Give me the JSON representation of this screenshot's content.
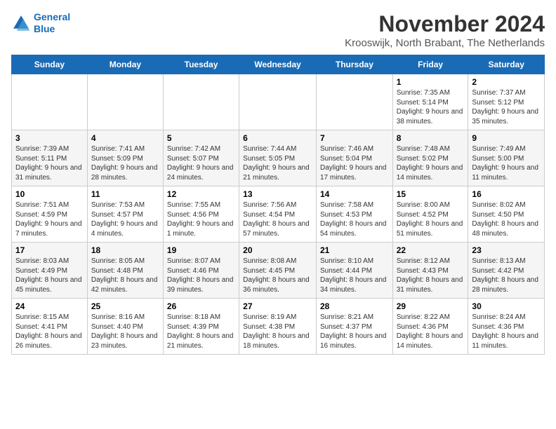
{
  "logo": {
    "line1": "General",
    "line2": "Blue"
  },
  "title": "November 2024",
  "subtitle": "Krooswijk, North Brabant, The Netherlands",
  "days_of_week": [
    "Sunday",
    "Monday",
    "Tuesday",
    "Wednesday",
    "Thursday",
    "Friday",
    "Saturday"
  ],
  "weeks": [
    [
      {
        "day": "",
        "info": ""
      },
      {
        "day": "",
        "info": ""
      },
      {
        "day": "",
        "info": ""
      },
      {
        "day": "",
        "info": ""
      },
      {
        "day": "",
        "info": ""
      },
      {
        "day": "1",
        "info": "Sunrise: 7:35 AM\nSunset: 5:14 PM\nDaylight: 9 hours and 38 minutes."
      },
      {
        "day": "2",
        "info": "Sunrise: 7:37 AM\nSunset: 5:12 PM\nDaylight: 9 hours and 35 minutes."
      }
    ],
    [
      {
        "day": "3",
        "info": "Sunrise: 7:39 AM\nSunset: 5:11 PM\nDaylight: 9 hours and 31 minutes."
      },
      {
        "day": "4",
        "info": "Sunrise: 7:41 AM\nSunset: 5:09 PM\nDaylight: 9 hours and 28 minutes."
      },
      {
        "day": "5",
        "info": "Sunrise: 7:42 AM\nSunset: 5:07 PM\nDaylight: 9 hours and 24 minutes."
      },
      {
        "day": "6",
        "info": "Sunrise: 7:44 AM\nSunset: 5:05 PM\nDaylight: 9 hours and 21 minutes."
      },
      {
        "day": "7",
        "info": "Sunrise: 7:46 AM\nSunset: 5:04 PM\nDaylight: 9 hours and 17 minutes."
      },
      {
        "day": "8",
        "info": "Sunrise: 7:48 AM\nSunset: 5:02 PM\nDaylight: 9 hours and 14 minutes."
      },
      {
        "day": "9",
        "info": "Sunrise: 7:49 AM\nSunset: 5:00 PM\nDaylight: 9 hours and 11 minutes."
      }
    ],
    [
      {
        "day": "10",
        "info": "Sunrise: 7:51 AM\nSunset: 4:59 PM\nDaylight: 9 hours and 7 minutes."
      },
      {
        "day": "11",
        "info": "Sunrise: 7:53 AM\nSunset: 4:57 PM\nDaylight: 9 hours and 4 minutes."
      },
      {
        "day": "12",
        "info": "Sunrise: 7:55 AM\nSunset: 4:56 PM\nDaylight: 9 hours and 1 minute."
      },
      {
        "day": "13",
        "info": "Sunrise: 7:56 AM\nSunset: 4:54 PM\nDaylight: 8 hours and 57 minutes."
      },
      {
        "day": "14",
        "info": "Sunrise: 7:58 AM\nSunset: 4:53 PM\nDaylight: 8 hours and 54 minutes."
      },
      {
        "day": "15",
        "info": "Sunrise: 8:00 AM\nSunset: 4:52 PM\nDaylight: 8 hours and 51 minutes."
      },
      {
        "day": "16",
        "info": "Sunrise: 8:02 AM\nSunset: 4:50 PM\nDaylight: 8 hours and 48 minutes."
      }
    ],
    [
      {
        "day": "17",
        "info": "Sunrise: 8:03 AM\nSunset: 4:49 PM\nDaylight: 8 hours and 45 minutes."
      },
      {
        "day": "18",
        "info": "Sunrise: 8:05 AM\nSunset: 4:48 PM\nDaylight: 8 hours and 42 minutes."
      },
      {
        "day": "19",
        "info": "Sunrise: 8:07 AM\nSunset: 4:46 PM\nDaylight: 8 hours and 39 minutes."
      },
      {
        "day": "20",
        "info": "Sunrise: 8:08 AM\nSunset: 4:45 PM\nDaylight: 8 hours and 36 minutes."
      },
      {
        "day": "21",
        "info": "Sunrise: 8:10 AM\nSunset: 4:44 PM\nDaylight: 8 hours and 34 minutes."
      },
      {
        "day": "22",
        "info": "Sunrise: 8:12 AM\nSunset: 4:43 PM\nDaylight: 8 hours and 31 minutes."
      },
      {
        "day": "23",
        "info": "Sunrise: 8:13 AM\nSunset: 4:42 PM\nDaylight: 8 hours and 28 minutes."
      }
    ],
    [
      {
        "day": "24",
        "info": "Sunrise: 8:15 AM\nSunset: 4:41 PM\nDaylight: 8 hours and 26 minutes."
      },
      {
        "day": "25",
        "info": "Sunrise: 8:16 AM\nSunset: 4:40 PM\nDaylight: 8 hours and 23 minutes."
      },
      {
        "day": "26",
        "info": "Sunrise: 8:18 AM\nSunset: 4:39 PM\nDaylight: 8 hours and 21 minutes."
      },
      {
        "day": "27",
        "info": "Sunrise: 8:19 AM\nSunset: 4:38 PM\nDaylight: 8 hours and 18 minutes."
      },
      {
        "day": "28",
        "info": "Sunrise: 8:21 AM\nSunset: 4:37 PM\nDaylight: 8 hours and 16 minutes."
      },
      {
        "day": "29",
        "info": "Sunrise: 8:22 AM\nSunset: 4:36 PM\nDaylight: 8 hours and 14 minutes."
      },
      {
        "day": "30",
        "info": "Sunrise: 8:24 AM\nSunset: 4:36 PM\nDaylight: 8 hours and 11 minutes."
      }
    ]
  ]
}
